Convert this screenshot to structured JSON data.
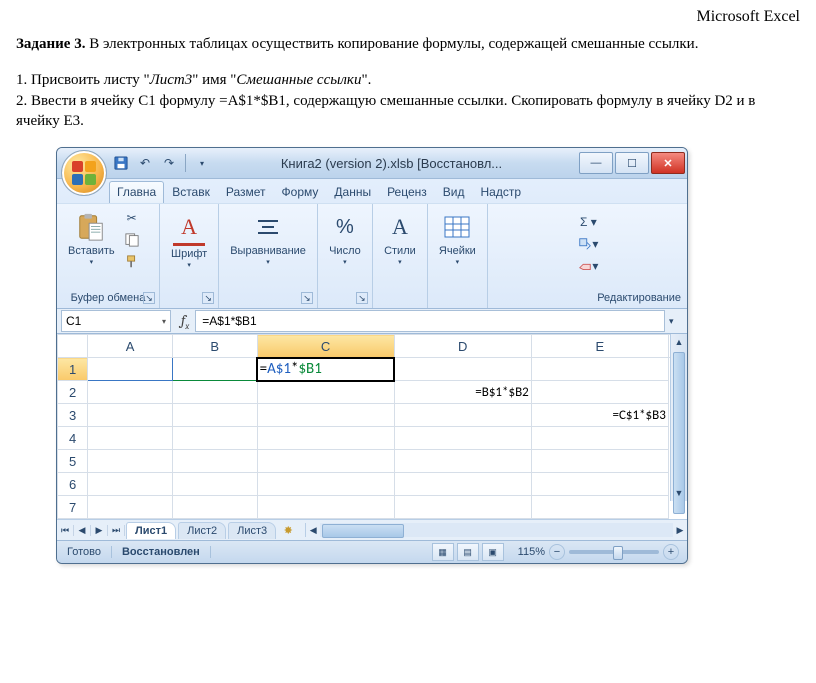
{
  "doc": {
    "app_name": "Microsoft Excel",
    "task_label": "Задание 3.",
    "task_text": " В электронных таблицах осуществить копирование формулы, содержащей смешанные ссылки.",
    "step1_pre": "1. Присвоить листу \"",
    "step1_italic1": "Лист3",
    "step1_mid": "\" имя \"",
    "step1_italic2": "Смешанные ссылки",
    "step1_post": "\".",
    "step2": "2. Ввести в ячейку С1 формулу =A$1*$B1, содержащую смешанные ссылки. Скопировать формулу в ячейку D2 и в ячейку E3."
  },
  "excel": {
    "window_title": "Книга2 (version 2).xlsb [Восстановл...",
    "tabs": [
      "Главна",
      "Вставк",
      "Размет",
      "Форму",
      "Данны",
      "Реценз",
      "Вид",
      "Надстр"
    ],
    "active_tab_index": 0,
    "groups": {
      "clipboard": {
        "label": "Буфер обмена",
        "paste": "Вставить"
      },
      "font": {
        "label": "Шрифт"
      },
      "align": {
        "label": "Выравнивание"
      },
      "number": {
        "label": "Число"
      },
      "styles": {
        "label": "Стили"
      },
      "cells": {
        "label": "Ячейки"
      },
      "editing": {
        "label": "Редактирование"
      }
    },
    "namebox": "C1",
    "formula": "=A$1*$B1",
    "columns": [
      "A",
      "B",
      "C",
      "D",
      "E"
    ],
    "rows": [
      "1",
      "2",
      "3",
      "4",
      "5",
      "6",
      "7"
    ],
    "cells": {
      "C1_pre": "=",
      "C1_a": "A$1",
      "C1_mid": "*",
      "C1_b": "$B1",
      "D2": "=B$1*$B2",
      "E3": "=C$1*$B3"
    },
    "sheets": [
      "Лист1",
      "Лист2",
      "Лист3"
    ],
    "active_sheet_index": 0,
    "status_ready": "Готово",
    "status_recovered": "Восстановлен",
    "zoom": "115%"
  }
}
